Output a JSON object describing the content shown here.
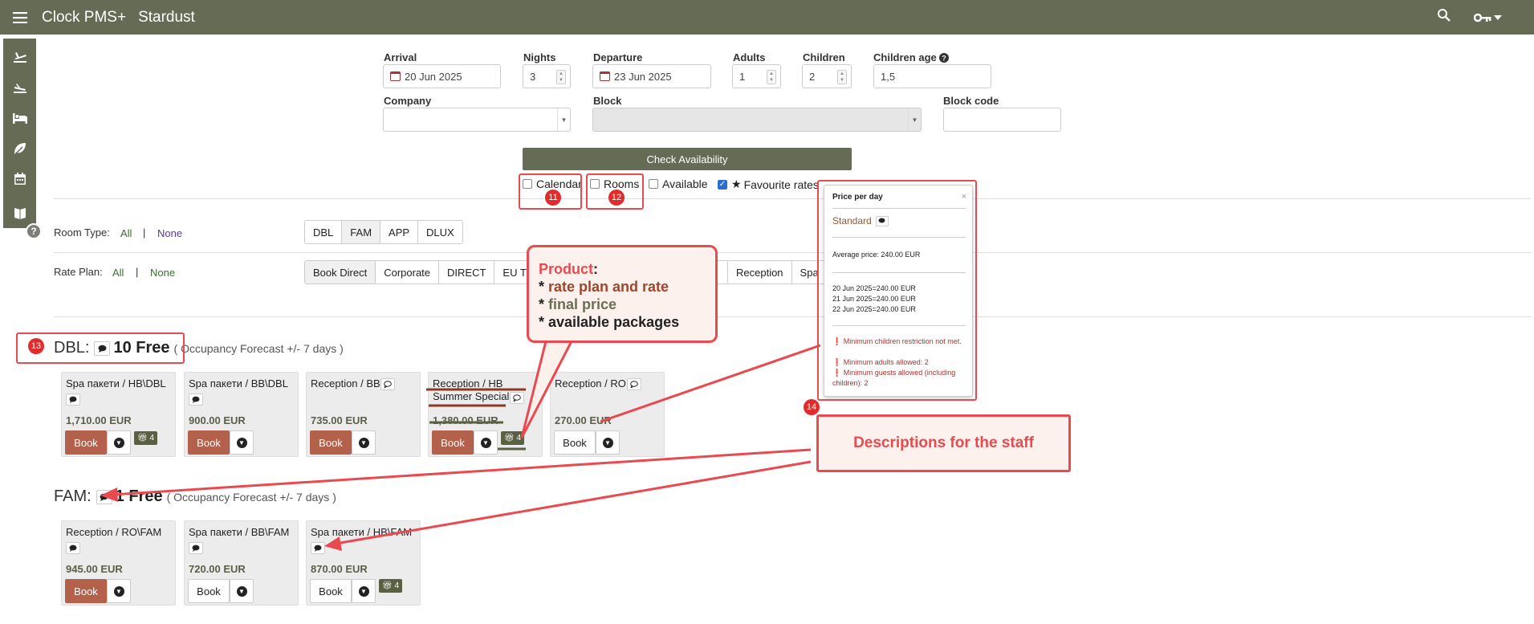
{
  "app": {
    "title": "Clock PMS+",
    "property": "Stardust"
  },
  "search": {
    "arrival_label": "Arrival",
    "arrival_value": "20 Jun 2025",
    "nights_label": "Nights",
    "nights_value": "3",
    "departure_label": "Departure",
    "departure_value": "23 Jun 2025",
    "adults_label": "Adults",
    "adults_value": "1",
    "children_label": "Children",
    "children_value": "2",
    "children_age_label": "Children age",
    "children_age_value": "1,5",
    "company_label": "Company",
    "block_label": "Block",
    "block_code_label": "Block code",
    "check_button": "Check Availability"
  },
  "options": {
    "calendar": "Calendar",
    "rooms": "Rooms",
    "available": "Available",
    "favourite": "Favourite rates"
  },
  "filters": {
    "room_type_label": "Room Type:",
    "rate_plan_label": "Rate Plan:",
    "all": "All",
    "none": "None",
    "sep": "|",
    "room_types": [
      "DBL",
      "FAM",
      "APP",
      "DLUX"
    ],
    "rate_plans": [
      "Book Direct",
      "Corporate",
      "DIRECT",
      "EU Tr",
      "Reception",
      "Spa"
    ]
  },
  "dbl": {
    "name": "DBL:",
    "free": "10 Free",
    "forecast": "( Occupancy Forecast +/- 7 days )",
    "cards": [
      {
        "name": "Spa пакети / HB\\DBL",
        "price": "1,710.00 EUR",
        "book": "Book",
        "pkg": "4"
      },
      {
        "name": "Spa пакети / BB\\DBL",
        "price": "900.00 EUR",
        "book": "Book"
      },
      {
        "name": "Reception / BB",
        "price": "735.00 EUR",
        "book": "Book"
      },
      {
        "name": "Reception / HB Summer Special",
        "price": "1,380.00 EUR",
        "book": "Book",
        "pkg": "4"
      },
      {
        "name": "Reception / RO",
        "price": "270.00 EUR",
        "book": "Book"
      }
    ]
  },
  "fam": {
    "name": "FAM:",
    "free": "1 Free",
    "forecast": "( Occupancy Forecast +/- 7 days )",
    "cards": [
      {
        "name": "Reception / RO\\FAM",
        "price": "945.00 EUR",
        "book": "Book"
      },
      {
        "name": "Spa пакети / BB\\FAM",
        "price": "720.00 EUR",
        "book": "Book"
      },
      {
        "name": "Spa пакети / HB\\FAM",
        "price": "870.00 EUR",
        "book": "Book",
        "pkg": "4"
      }
    ]
  },
  "popup": {
    "title": "Price per day",
    "close": "×",
    "rate": "Standard",
    "average": "Average price: 240.00 EUR",
    "day1": "20 Jun 2025=240.00 EUR",
    "day2": "21 Jun 2025=240.00 EUR",
    "day3": "22 Jun 2025=240.00 EUR",
    "warn1": "Minimum children restriction not met.",
    "warn2": "Minimum adults allowed: 2",
    "warn3": "Minimum guests allowed (including children): 2"
  },
  "annotations": {
    "b11": "11",
    "b12": "12",
    "b13": "13",
    "b14": "14",
    "bubble_title": "Product",
    "bubble_colon": ":",
    "bubble_star": "* ",
    "bubble_line1": "rate plan and rate",
    "bubble_line2": "final price",
    "bubble_line3": "available packages",
    "description": "Descriptions for the staff"
  },
  "help": "?",
  "colors": {
    "topbar": "#656b54",
    "book": "#b4614c",
    "annotation": "#e94a4f"
  }
}
